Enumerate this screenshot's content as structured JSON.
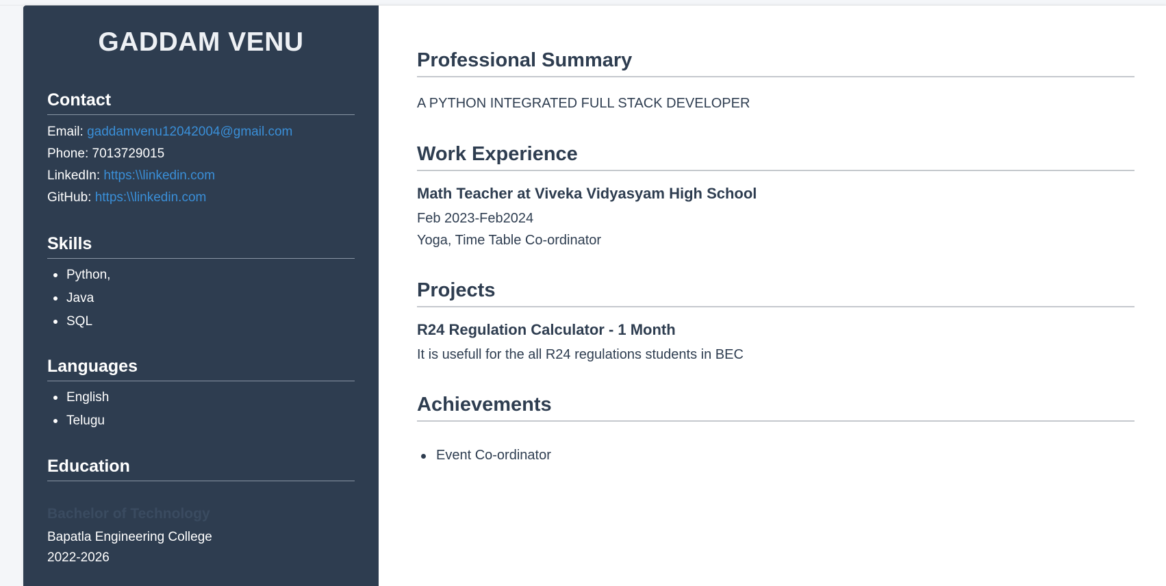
{
  "sidebar": {
    "name": "GADDAM VENU",
    "contact": {
      "title": "Contact",
      "email_label": "Email:",
      "email": "gaddamvenu12042004@gmail.com",
      "phone_label": "Phone:",
      "phone": "7013729015",
      "linkedin_label": "LinkedIn:",
      "linkedin": "https:\\\\linkedin.com",
      "github_label": "GitHub:",
      "github": "https:\\\\linkedin.com"
    },
    "skills": {
      "title": "Skills",
      "items": [
        "Python,",
        "Java",
        "SQL"
      ]
    },
    "languages": {
      "title": "Languages",
      "items": [
        "English",
        "Telugu"
      ]
    },
    "education": {
      "title": "Education",
      "degree": "Bachelor of Technology",
      "college": "Bapatla Engineering College",
      "years": "2022-2026"
    }
  },
  "main": {
    "summary": {
      "title": "Professional Summary",
      "text": "A PYTHON INTEGRATED FULL STACK DEVELOPER"
    },
    "experience": {
      "title": "Work Experience",
      "role": "Math Teacher at Viveka Vidyasyam High School",
      "dates": "Feb 2023-Feb2024",
      "details": "Yoga, Time Table Co-ordinator"
    },
    "projects": {
      "title": "Projects",
      "name": "R24 Regulation Calculator - 1 Month",
      "description": "It is usefull for the all R24 regulations students in BEC"
    },
    "achievements": {
      "title": "Achievements",
      "items": [
        "Event Co-ordinator"
      ]
    }
  },
  "colors": {
    "sidebar_bg": "#2e3d50",
    "link": "#3a8fd8",
    "text_dark": "#2e3d50"
  }
}
